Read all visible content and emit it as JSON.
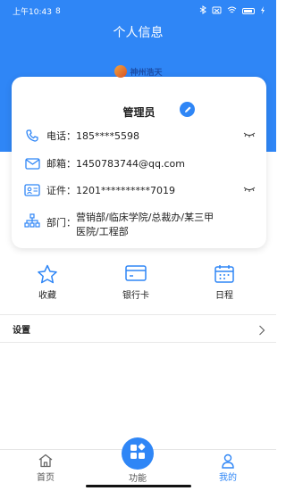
{
  "status_bar": {
    "time": "上午10:43",
    "carrier_icon": "8",
    "battery_label": ""
  },
  "header": {
    "title": "个人信息"
  },
  "logo": {
    "text": "神州浩天"
  },
  "profile": {
    "name": "管理员",
    "rows": [
      {
        "label": "电话：",
        "value": "185****5598",
        "icon": "phone-icon",
        "masked": true
      },
      {
        "label": "邮箱：",
        "value": "1450783744@qq.com",
        "icon": "mail-icon",
        "masked": false
      },
      {
        "label": "证件：",
        "value": "1201**********7019",
        "icon": "id-card-icon",
        "masked": true
      },
      {
        "label": "部门：",
        "value_line1": "营销部/临床学院/总裁办/某三甲",
        "value_line2": "医院/工程部",
        "icon": "org-chart-icon"
      }
    ]
  },
  "quick_actions": [
    {
      "label": "收藏",
      "icon": "star-icon"
    },
    {
      "label": "银行卡",
      "icon": "bank-card-icon"
    },
    {
      "label": "日程",
      "icon": "calendar-icon"
    }
  ],
  "settings": {
    "label": "设置"
  },
  "tabbar": {
    "items": [
      {
        "label": "首页",
        "icon": "home-icon"
      },
      {
        "label": "功能",
        "icon": "apps-icon"
      },
      {
        "label": "我的",
        "icon": "user-icon"
      }
    ],
    "active": "我的"
  },
  "colors": {
    "primary": "#2f86f6",
    "text": "#1f1f1f"
  }
}
